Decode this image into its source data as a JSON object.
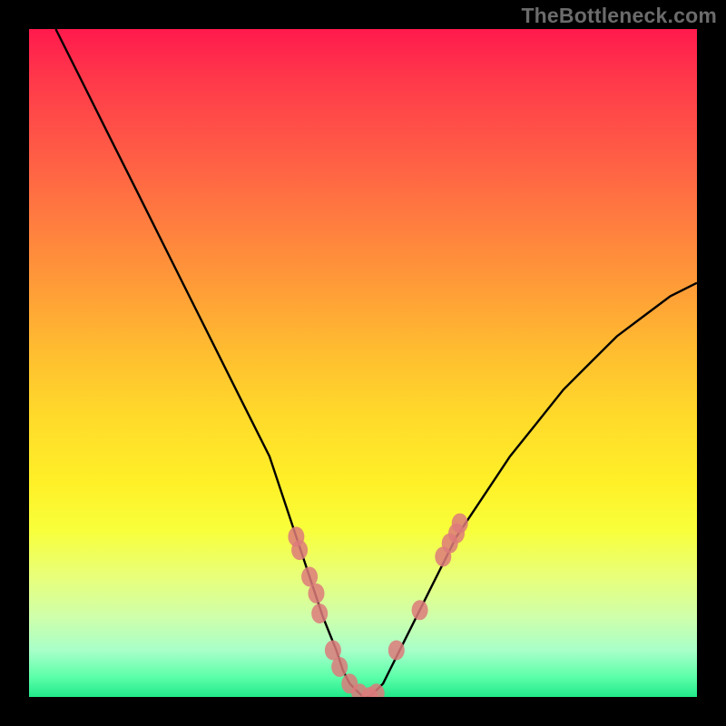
{
  "watermark": "TheBottleneck.com",
  "chart_data": {
    "type": "line",
    "title": "",
    "xlabel": "",
    "ylabel": "",
    "xlim": [
      0,
      100
    ],
    "ylim": [
      0,
      100
    ],
    "grid": false,
    "legend": false,
    "note": "Axes unlabeled; values estimated from pixel positions on a 0–100 scale. y≈0 at bottom (green), y≈100 at top (red).",
    "series": [
      {
        "name": "curve",
        "stroke": "#000000",
        "x": [
          4,
          8,
          12,
          16,
          20,
          24,
          28,
          32,
          36,
          40,
          42,
          44,
          46,
          47,
          48,
          49,
          50,
          51,
          52,
          53,
          54,
          56,
          58,
          60,
          64,
          68,
          72,
          76,
          80,
          84,
          88,
          92,
          96,
          100
        ],
        "y": [
          100,
          92,
          84,
          76,
          68,
          60,
          52,
          44,
          36,
          24,
          18,
          12,
          7,
          4,
          2,
          1,
          0,
          0,
          1,
          2,
          4,
          8,
          12,
          16,
          24,
          30,
          36,
          41,
          46,
          50,
          54,
          57,
          60,
          62
        ]
      },
      {
        "name": "points-left-branch",
        "type": "scatter",
        "color": "#dd7a7a",
        "x": [
          40.0,
          40.5,
          42.0,
          43.0,
          43.5,
          45.5,
          46.5,
          48.0,
          49.5,
          51.0,
          52.0
        ],
        "y": [
          24.0,
          22.0,
          18.0,
          15.5,
          12.5,
          7.0,
          4.5,
          2.0,
          0.5,
          0.0,
          0.5
        ]
      },
      {
        "name": "points-right-branch",
        "type": "scatter",
        "color": "#dd7a7a",
        "x": [
          55.0,
          58.5,
          62.0,
          63.0,
          64.0,
          64.5
        ],
        "y": [
          7.0,
          13.0,
          21.0,
          23.0,
          24.5,
          26.0
        ]
      }
    ]
  }
}
